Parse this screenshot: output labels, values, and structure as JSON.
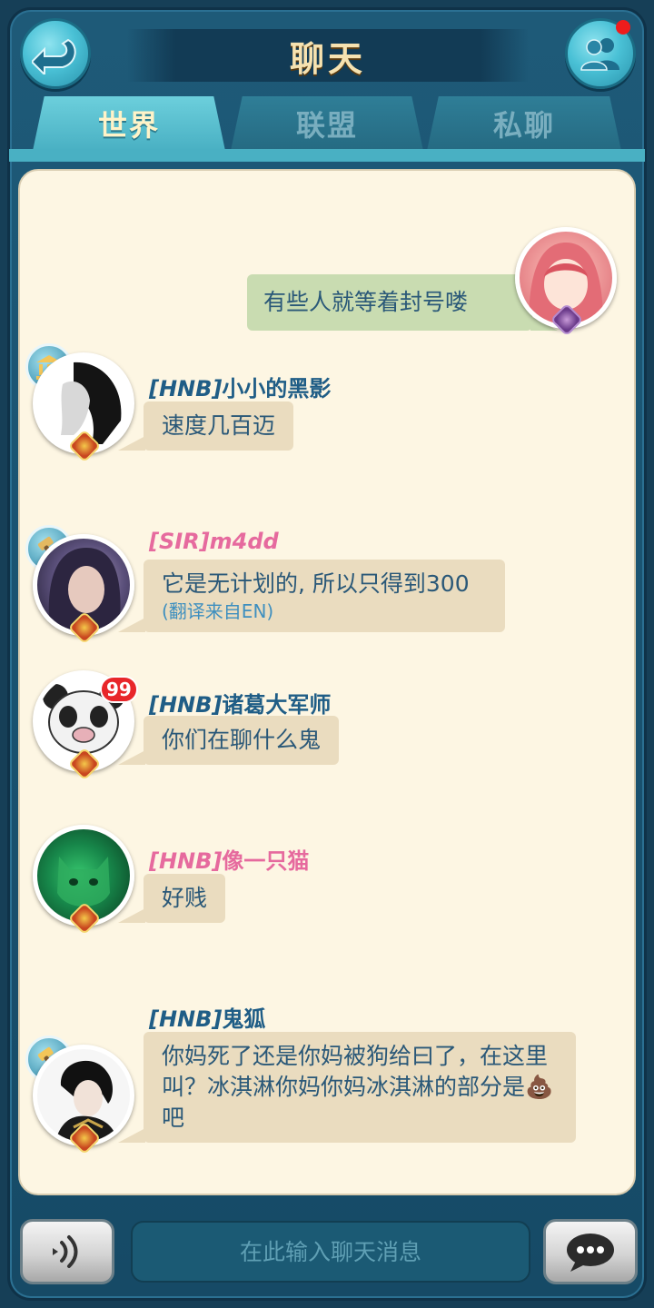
{
  "header": {
    "title": "聊天",
    "back_icon": "back-arrow-icon",
    "friends_icon": "friends-icon",
    "has_notification": true
  },
  "tabs": [
    {
      "label": "世界",
      "active": true
    },
    {
      "label": "联盟",
      "active": false
    },
    {
      "label": "私聊",
      "active": false
    }
  ],
  "messages": [
    {
      "mine": true,
      "text": "有些人就等着封号喽"
    },
    {
      "tag": "[HNB]",
      "name": "小小的黑影",
      "name_color": "blue",
      "role_icon": "bank-icon",
      "text": "速度几百迈"
    },
    {
      "tag": "[SIR]",
      "name": "m4dd",
      "name_color": "pink",
      "role_icon": "hammer-icon",
      "text": "它是无计划的, 所以只得到300",
      "note": "(翻译来自EN)"
    },
    {
      "tag": "[HNB]",
      "name": "诸葛大军师",
      "name_color": "blue",
      "unread": "99",
      "text": "你们在聊什么鬼"
    },
    {
      "tag": "[HNB]",
      "name": "像一只猫",
      "name_color": "pink",
      "text": "好贱"
    },
    {
      "tag": "[HNB]",
      "name": "鬼狐",
      "name_color": "blue",
      "role_icon": "hammer-icon",
      "text": "你妈死了还是你妈被狗给曰了，在这里叫？冰淇淋你妈你妈冰淇淋的部分是💩吧"
    }
  ],
  "input": {
    "placeholder": "在此输入聊天消息",
    "value": ""
  },
  "bottom": {
    "voice_icon": "voice-icon",
    "send_icon": "chat-bubble-icon"
  },
  "colors": {
    "frame": "#1e5a78",
    "panel": "#fdf6e3",
    "bubble": "#eadcbf",
    "bubble_mine": "#c9dcb1",
    "name_blue": "#1f5d86",
    "name_pink": "#e66a9e"
  }
}
